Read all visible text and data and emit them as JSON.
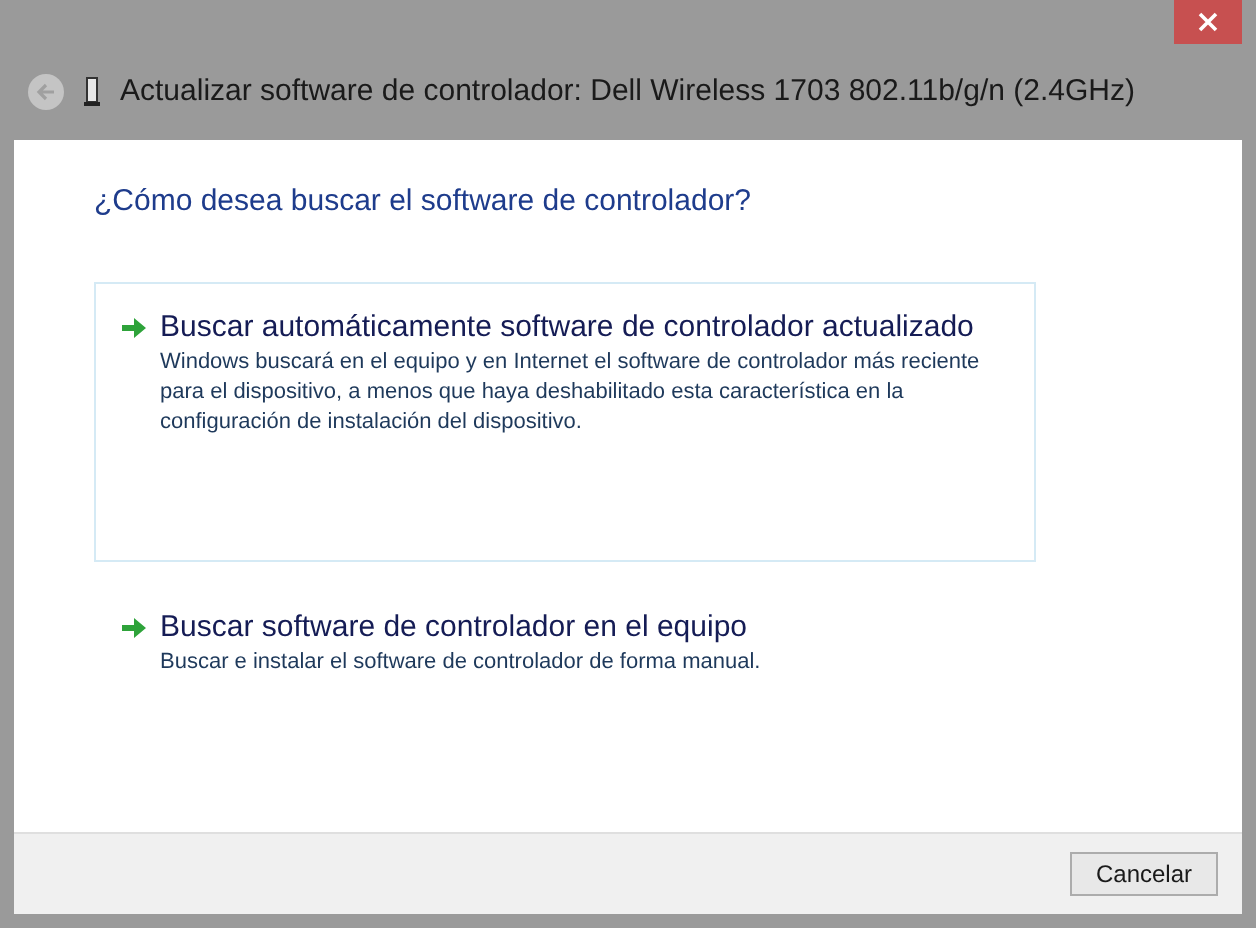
{
  "window": {
    "title": "Actualizar software de controlador: Dell Wireless 1703 802.11b/g/n (2.4GHz)"
  },
  "heading": "¿Cómo desea buscar el software de controlador?",
  "options": [
    {
      "title": "Buscar automáticamente software de controlador actualizado",
      "description": "Windows buscará en el equipo y en Internet el software de controlador más reciente para el dispositivo, a menos que haya deshabilitado esta característica en la configuración de instalación del dispositivo.",
      "selected": true
    },
    {
      "title": "Buscar software de controlador en el equipo",
      "description": "Buscar e instalar el software de controlador de forma manual.",
      "selected": false
    }
  ],
  "buttons": [
    "Cancelar"
  ]
}
